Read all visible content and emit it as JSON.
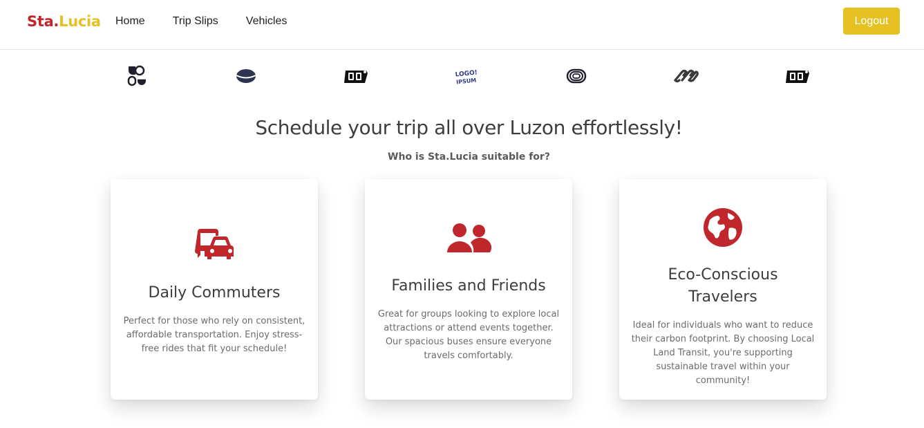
{
  "navbar": {
    "brand_part1": "Sta.",
    "brand_part2": "Lucia",
    "links": [
      "Home",
      "Trip Slips",
      "Vehicles"
    ],
    "logout_label": "Logout"
  },
  "logos": [
    "blocks-logo",
    "lips-logo",
    "oo-logo",
    "logoipsum-logo",
    "rings-logo",
    "infinity-logo",
    "oo-logo"
  ],
  "logo_text": "LOGO! IPSUM",
  "hero": {
    "title": "Schedule your trip all over Luzon effortlessly!",
    "subtitle": "Who is Sta.Lucia suitable for?"
  },
  "cards": [
    {
      "icon": "bus-car-icon",
      "title": "Daily Commuters",
      "description": "Perfect for those who rely on consistent, affordable transportation. Enjoy stress-free rides that fit your schedule!"
    },
    {
      "icon": "users-icon",
      "title": "Families and Friends",
      "description": "Great for groups looking to explore local attractions or attend events together. Our spacious buses ensure everyone travels comfortably."
    },
    {
      "icon": "globe-icon",
      "title": "Eco-Conscious Travelers",
      "description": "Ideal for individuals who want to reduce their carbon footprint. By choosing Local Land Transit, you're supporting sustainable travel within your community!"
    }
  ],
  "colors": {
    "brand_red": "#c0272d",
    "brand_yellow": "#e6c124",
    "icon_red": "#c0272d",
    "logo_dark": "#1f1f2e"
  }
}
